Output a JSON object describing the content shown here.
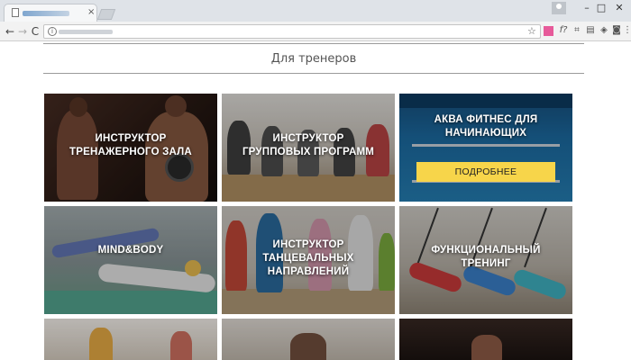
{
  "browser": {
    "tab_close": "×",
    "window_controls": {
      "minimize": "–",
      "maximize": "□",
      "close": "✕"
    },
    "nav": {
      "back": "←",
      "forward": "→",
      "reload": "C"
    },
    "info_glyph": "i",
    "star_glyph": "☆",
    "extensions": [
      {
        "icon": "pink-square-icon",
        "glyph": "",
        "color": "#e75a9a"
      },
      {
        "icon": "formula-icon",
        "glyph": "f?",
        "color": ""
      },
      {
        "icon": "frame-icon",
        "glyph": "⌗",
        "color": ""
      },
      {
        "icon": "layers-icon",
        "glyph": "▤",
        "color": ""
      },
      {
        "icon": "tag-icon",
        "glyph": "◈",
        "color": ""
      },
      {
        "icon": "camera-icon",
        "glyph": "◙",
        "color": ""
      },
      {
        "icon": "menu-icon",
        "glyph": "⋮",
        "color": ""
      }
    ]
  },
  "section": {
    "title": "Для тренеров"
  },
  "cards": [
    {
      "title": "ИНСТРУКТОР ТРЕНАЖЕРНОГО ЗАЛА",
      "line1": "ИНСТРУКТОР",
      "line2": "ТРЕНАЖЕРНОГО ЗАЛА"
    },
    {
      "title": "ИНСТРУКТОР ГРУППОВЫХ ПРОГРАММ",
      "line1": "ИНСТРУКТОР",
      "line2": "ГРУППОВЫХ ПРОГРАММ"
    },
    {
      "title": "АКВА ФИТНЕС ДЛЯ НАЧИНАЮЩИХ",
      "line1": "АКВА ФИТНЕС ДЛЯ",
      "line2": "НАЧИНАЮЩИХ",
      "button": "ПОДРОБНЕЕ"
    },
    {
      "title": "MIND&BODY",
      "line1": "MIND&BODY"
    },
    {
      "title": "ИНСТРУКТОР ТАНЦЕВАЛЬНЫХ НАПРАВЛЕНИЙ",
      "line1": "ИНСТРУКТОР",
      "line2": "ТАНЦЕВАЛЬНЫХ",
      "line3": "НАПРАВЛЕНИЙ"
    },
    {
      "title": "ФУНКЦИОНАЛЬНЫЙ ТРЕНИНГ",
      "line1": "ФУНКЦИОНАЛЬНЫЙ",
      "line2": "ТРЕНИНГ"
    }
  ],
  "colors": {
    "accent_button": "#f7d54a",
    "divider": "#9a9a9a"
  }
}
